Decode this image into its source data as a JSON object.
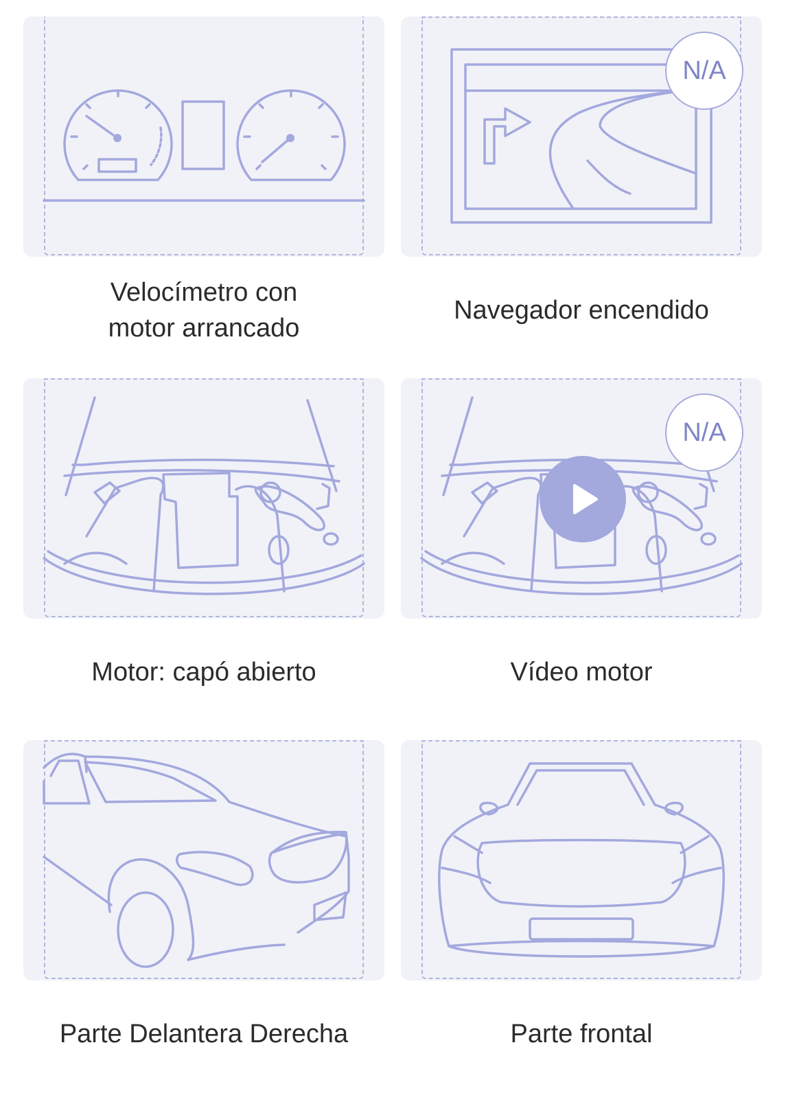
{
  "tiles": [
    {
      "caption": "Velocímetro con\nmotor arrancado"
    },
    {
      "caption": "Navegador encendido",
      "badge": "N/A"
    },
    {
      "caption": "Motor: capó abierto"
    },
    {
      "caption": "Vídeo motor",
      "badge": "N/A"
    },
    {
      "caption": "Parte Delantera Derecha"
    },
    {
      "caption": "Parte frontal"
    }
  ],
  "colors": {
    "line": "#a3a8dd",
    "card": "#f1f2f8",
    "badge_text": "#7e84c6"
  }
}
